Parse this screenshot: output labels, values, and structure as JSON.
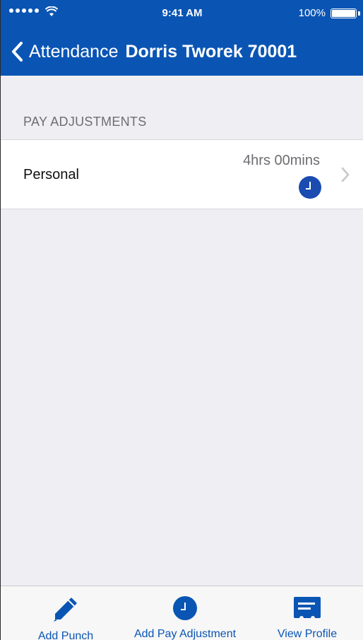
{
  "status_bar": {
    "time": "9:41 AM",
    "battery": "100%"
  },
  "nav": {
    "back_label": "Attendance",
    "title": "Dorris Tworek 70001"
  },
  "section": {
    "header": "PAY ADJUSTMENTS",
    "rows": [
      {
        "label": "Personal",
        "value": "4hrs 00mins",
        "icon": "clock-icon"
      }
    ]
  },
  "tab_bar": {
    "tabs": [
      {
        "label": "Add Punch",
        "icon": "pencil-icon"
      },
      {
        "label": "Add Pay Adjustment",
        "icon": "clock-icon"
      },
      {
        "label": "View Profile",
        "icon": "id-card-icon"
      }
    ]
  },
  "colors": {
    "brand_blue": "#0a55b4",
    "clock_blue": "#1a4bb0",
    "background": "#efeef3"
  }
}
